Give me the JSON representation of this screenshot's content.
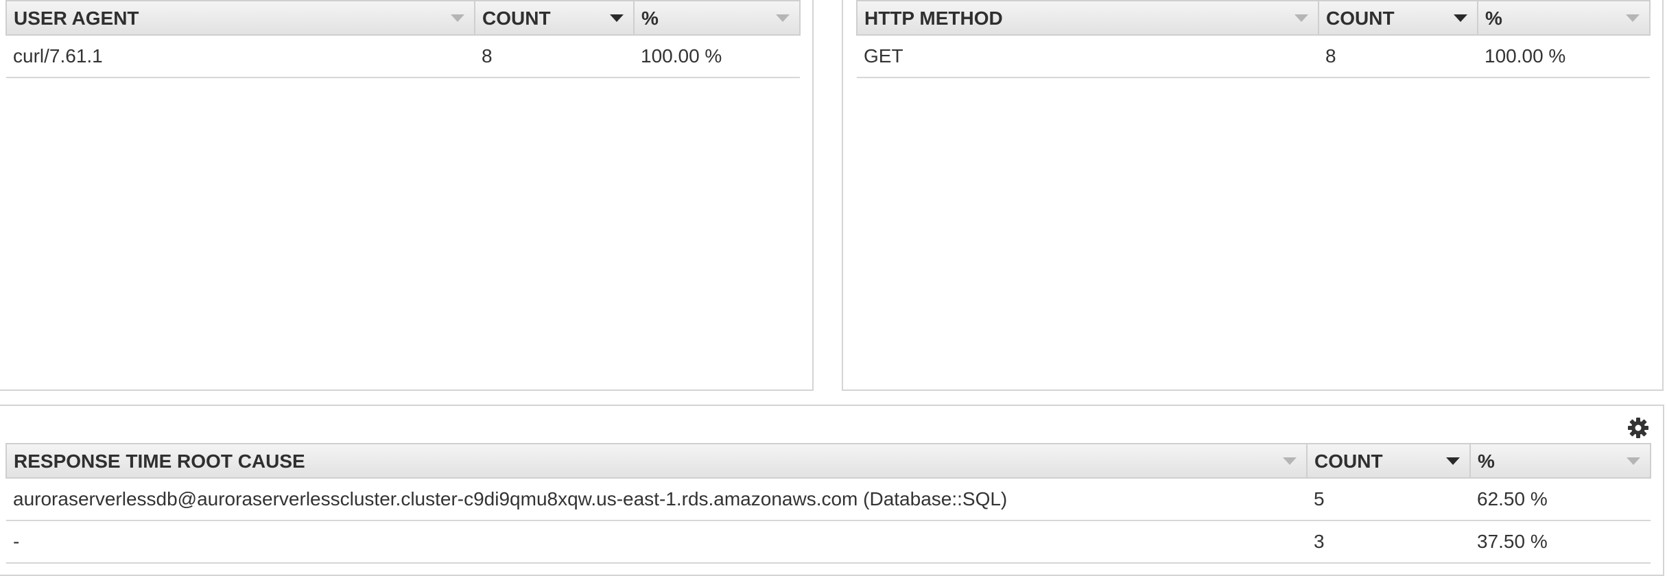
{
  "user_agent_table": {
    "columns": [
      {
        "label": "USER AGENT",
        "sort_active": false
      },
      {
        "label": "COUNT",
        "sort_active": true
      },
      {
        "label": "%",
        "sort_active": false
      }
    ],
    "rows": [
      [
        "curl/7.61.1",
        "8",
        "100.00 %"
      ]
    ]
  },
  "http_method_table": {
    "columns": [
      {
        "label": "HTTP METHOD",
        "sort_active": false
      },
      {
        "label": "COUNT",
        "sort_active": true
      },
      {
        "label": "%",
        "sort_active": false
      }
    ],
    "rows": [
      [
        "GET",
        "8",
        "100.00 %"
      ]
    ]
  },
  "root_cause_table": {
    "columns": [
      {
        "label": "RESPONSE TIME ROOT CAUSE",
        "sort_active": false
      },
      {
        "label": "COUNT",
        "sort_active": true
      },
      {
        "label": "%",
        "sort_active": false
      }
    ],
    "rows": [
      [
        "auroraserverlessdb@auroraserverlesscluster.cluster-c9di9qmu8xqw.us-east-1.rds.amazonaws.com (Database::SQL)",
        "5",
        "62.50 %"
      ],
      [
        "-",
        "3",
        "37.50 %"
      ]
    ]
  },
  "settings_icon": "gear-icon",
  "colors": {
    "header_top": "#f4f4f4",
    "header_bottom": "#e2e2e2",
    "border": "#d4d4d4",
    "text": "#333333"
  }
}
